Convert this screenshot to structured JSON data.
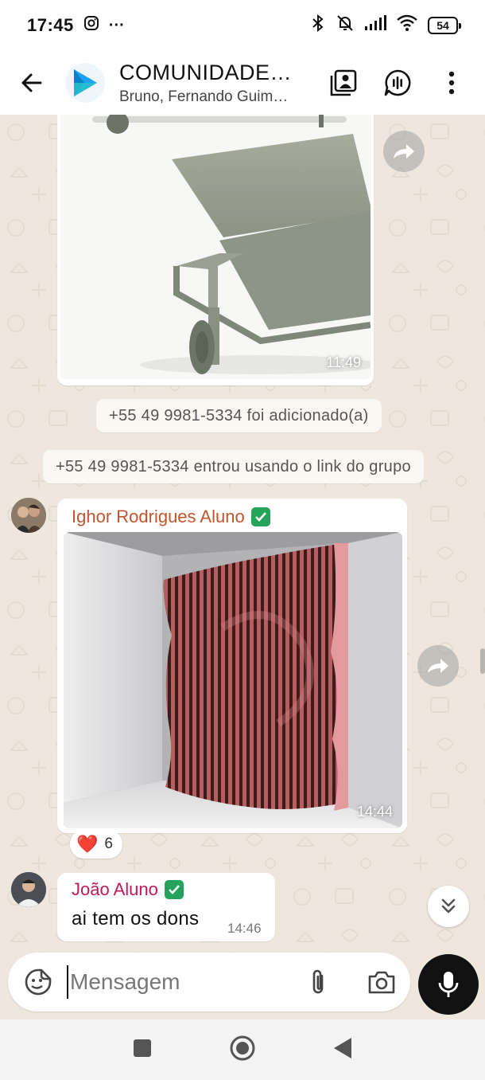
{
  "status_bar": {
    "time": "17:45",
    "more": "···",
    "battery": "54"
  },
  "header": {
    "title": "COMUNIDADE…",
    "members": "Bruno, Fernando Guim…"
  },
  "messages": {
    "image1": {
      "time": "11:49"
    },
    "system1": "+55 49 9981-5334 foi adicionado(a)",
    "system2": "+55 49 9981-5334 entrou usando o link do grupo",
    "ighor": {
      "sender": "Ighor Rodrigues Aluno",
      "sender_color": "#c0552f",
      "time": "14:44",
      "reaction_emoji": "❤️",
      "reaction_count": "6"
    },
    "joao": {
      "sender": "João Aluno",
      "sender_color": "#c2185b",
      "text": "ai tem os dons",
      "time": "14:46"
    }
  },
  "composer": {
    "placeholder": "Mensagem"
  },
  "colors": {
    "wallpaper": "#efe7de",
    "verified": "#25a35a",
    "logo": "#1da1f2"
  }
}
